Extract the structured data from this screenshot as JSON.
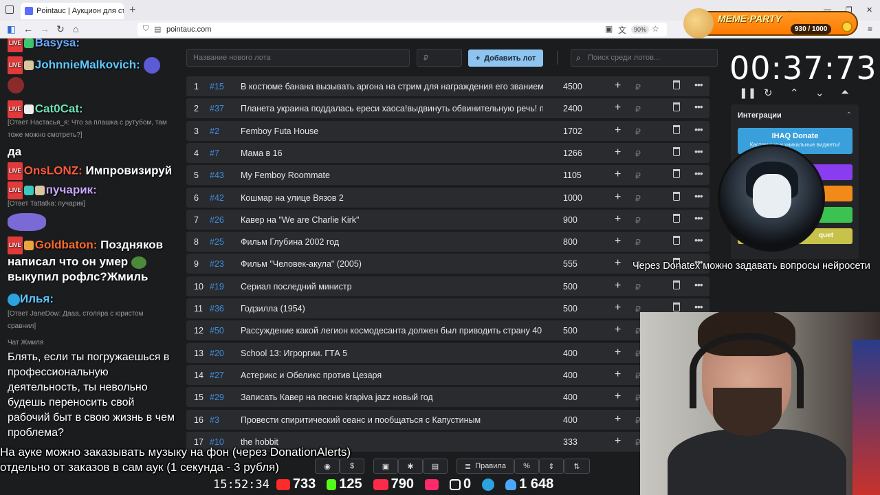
{
  "browser": {
    "tab_title": "Pointauc | Аукцион для стриме",
    "url": "pointauc.com",
    "zoom": "90%"
  },
  "meme_party": {
    "title": "MEME·PARTY",
    "count": "930 / 1000"
  },
  "chat": {
    "messages": [
      {
        "user": "Basysa:"
      },
      {
        "user": "JohnnieMalkovich:"
      },
      {
        "user": "Cat0Cat:"
      },
      {
        "reply": "[Ответ Настасья_я: Что за плашка с рутубом, там тоже можно смотреть?]"
      },
      {
        "text": "да"
      },
      {
        "user": "OnsLONZ:",
        "text": "Импровизируй"
      },
      {
        "user": "пучарик:"
      },
      {
        "reply": "[Ответ Tattatka: пучарик]"
      },
      {
        "user": "Goldbaton:",
        "text": "Поздняков написал что он умер",
        "text2": "выкупил рофлс?",
        "bold": "Жмиль"
      },
      {
        "user": "Илья:"
      },
      {
        "reply": "[Ответ JaneDow: Дааа, столяра с юристом сравнил]"
      },
      {
        "chatname": "Чат Жмиля"
      },
      {
        "text": "Блять, если ты погружаешься в профессиональную деятельность, ты невольно будешь переносить свой рабочий быт в свою жизнь в чем проблема?"
      }
    ]
  },
  "controls": {
    "new_lot_placeholder": "Название нового лота",
    "price_placeholder": "₽",
    "add_button": "Добавить лот",
    "search_placeholder": "Поиск среди лотов..."
  },
  "lots": [
    {
      "n": "1",
      "id": "#15",
      "name": "В костюме банана вызывать аргона на стрим для награждения его званием",
      "amount": "4500"
    },
    {
      "n": "2",
      "id": "#37",
      "name": "Планета украина поддалась ереси хаоса!выдвинуть обвинительную речь! по",
      "amount": "2400"
    },
    {
      "n": "3",
      "id": "#2",
      "name": "Femboy Futa House",
      "amount": "1702"
    },
    {
      "n": "4",
      "id": "#7",
      "name": "Мама в 16",
      "amount": "1266"
    },
    {
      "n": "5",
      "id": "#43",
      "name": "My Femboy Roommate",
      "amount": "1105"
    },
    {
      "n": "6",
      "id": "#42",
      "name": "Кошмар на улице Вязов 2",
      "amount": "1000"
    },
    {
      "n": "7",
      "id": "#26",
      "name": "Кавер на \"We are Charlie Kirk\"",
      "amount": "900"
    },
    {
      "n": "8",
      "id": "#25",
      "name": "Фильм Глубина 2002 год",
      "amount": "800"
    },
    {
      "n": "9",
      "id": "#23",
      "name": "Фильм \"Человек-акула\" (2005)",
      "amount": "555"
    },
    {
      "n": "10",
      "id": "#19",
      "name": "Сериал последний министр",
      "amount": "500"
    },
    {
      "n": "11",
      "id": "#36",
      "name": "Годзилла (1954)",
      "amount": "500"
    },
    {
      "n": "12",
      "id": "#50",
      "name": "Рассуждение какой легион космодесанта должен был приводить страну 40",
      "amount": "500"
    },
    {
      "n": "13",
      "id": "#20",
      "name": "School 13: Игроргии. ГТА 5",
      "amount": "400"
    },
    {
      "n": "14",
      "id": "#27",
      "name": "Астерикс и Обеликс против Цезаря",
      "amount": "400"
    },
    {
      "n": "15",
      "id": "#29",
      "name": "Записать Кавер на песню krapiva jazz новый год",
      "amount": "400"
    },
    {
      "n": "16",
      "id": "#3",
      "name": "Провести спиритический сеанс и пообщаться с Капустиным",
      "amount": "400"
    },
    {
      "n": "17",
      "id": "#10",
      "name": "the hobbit",
      "amount": "333"
    }
  ],
  "timer": "00:37:73",
  "integrations": {
    "title": "Интеграции",
    "donate_label": "IHAQ Donate",
    "donate_sub": "Кастомные и уникальные виджеты!",
    "extra_label": "quet",
    "colors": [
      "#8a3df0",
      "#f28a1a",
      "#3cc250",
      "#c8c24a"
    ]
  },
  "overlay": {
    "right_subtitle": "Через Donatex можно задавать вопросы нейросети",
    "bottom_line1": "На ауке можно заказывать музыку на фон (через DonationAlerts)",
    "bottom_line2": "отдельно от заказов в сам аук (1 секунда - 3 рубля)"
  },
  "toolbar": {
    "rules": "Правила",
    "percent": "%"
  },
  "stats": {
    "clock": "15:52:34",
    "youtube": "733",
    "kick": "125",
    "vk": "790",
    "rutube": "0",
    "telegram": "",
    "viewers": "1 648"
  }
}
